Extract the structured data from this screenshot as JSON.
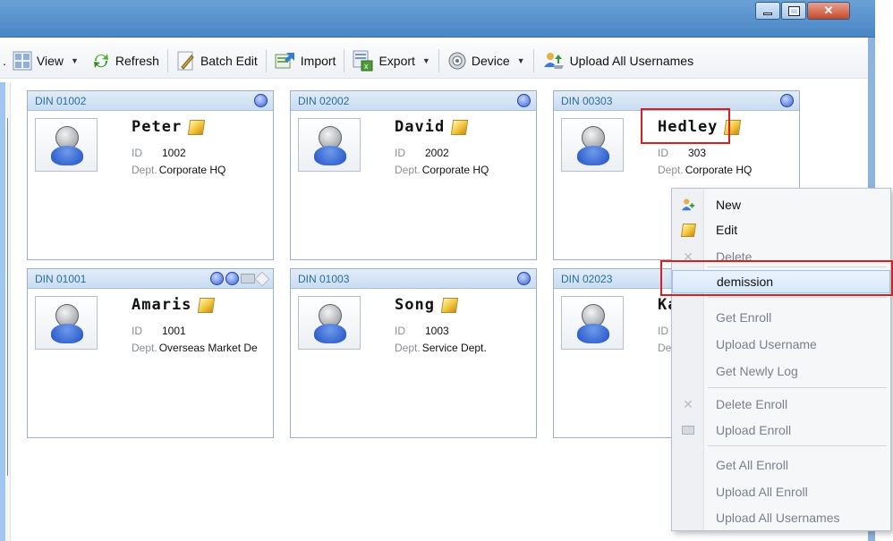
{
  "toolbar": {
    "items": [
      {
        "label": "View",
        "icon": "view-grid-icon",
        "dropdown": true
      },
      {
        "label": "Refresh",
        "icon": "refresh-icon",
        "dropdown": false
      },
      {
        "label": "Batch Edit",
        "icon": "batch-edit-icon",
        "dropdown": false
      },
      {
        "label": "Import",
        "icon": "import-icon",
        "dropdown": false
      },
      {
        "label": "Export",
        "icon": "export-icon",
        "dropdown": true
      },
      {
        "label": "Device",
        "icon": "device-icon",
        "dropdown": true
      },
      {
        "label": "Upload All Usernames",
        "icon": "upload-users-icon",
        "dropdown": false
      }
    ],
    "cut_prefix": "."
  },
  "users": [
    {
      "din": "DIN 01002",
      "name": "Peter",
      "id_label": "ID",
      "id": "1002",
      "dept_label": "Dept.",
      "dept": "Corporate HQ"
    },
    {
      "din": "DIN 02002",
      "name": "David",
      "id_label": "ID",
      "id": "2002",
      "dept_label": "Dept.",
      "dept": "Corporate HQ"
    },
    {
      "din": "DIN 00303",
      "name": "Hedley",
      "id_label": "ID",
      "id": "303",
      "dept_label": "Dept.",
      "dept": "Corporate HQ"
    },
    {
      "din": "DIN 01001",
      "name": "Amaris",
      "id_label": "ID",
      "id": "1001",
      "dept_label": "Dept.",
      "dept": "Overseas Market De"
    },
    {
      "din": "DIN 01003",
      "name": "Song",
      "id_label": "ID",
      "id": "1003",
      "dept_label": "Dept.",
      "dept": "Service Dept."
    },
    {
      "din": "DIN 02023",
      "name": "Ka",
      "id_label": "ID",
      "id": "",
      "dept_label": "Dep",
      "dept": ""
    }
  ],
  "context_menu": {
    "items": [
      {
        "label": "New",
        "icon": "new-user-icon",
        "enabled": true
      },
      {
        "label": "Edit",
        "icon": "edit-pencil-icon",
        "enabled": true
      },
      {
        "label": "Delete",
        "icon": "delete-x-icon",
        "enabled": false
      },
      {
        "label": "demission",
        "icon": "",
        "enabled": true,
        "highlighted": true
      },
      {
        "label": "Get Enroll",
        "icon": "",
        "enabled": false
      },
      {
        "label": "Upload Username",
        "icon": "",
        "enabled": false
      },
      {
        "label": "Get Newly Log",
        "icon": "",
        "enabled": false
      },
      {
        "label": "Delete Enroll",
        "icon": "delete-x-icon",
        "enabled": false
      },
      {
        "label": "Upload Enroll",
        "icon": "upload-enroll-icon",
        "enabled": false
      },
      {
        "label": "Get All Enroll",
        "icon": "",
        "enabled": false
      },
      {
        "label": "Upload All Enroll",
        "icon": "",
        "enabled": false
      },
      {
        "label": "Upload All Usernames",
        "icon": "",
        "enabled": false
      }
    ]
  },
  "colors": {
    "title_bar": "#4a86c6",
    "card_header": "#c9dcf2",
    "din_text": "#2a6d9a",
    "highlight_box": "#d62020"
  }
}
